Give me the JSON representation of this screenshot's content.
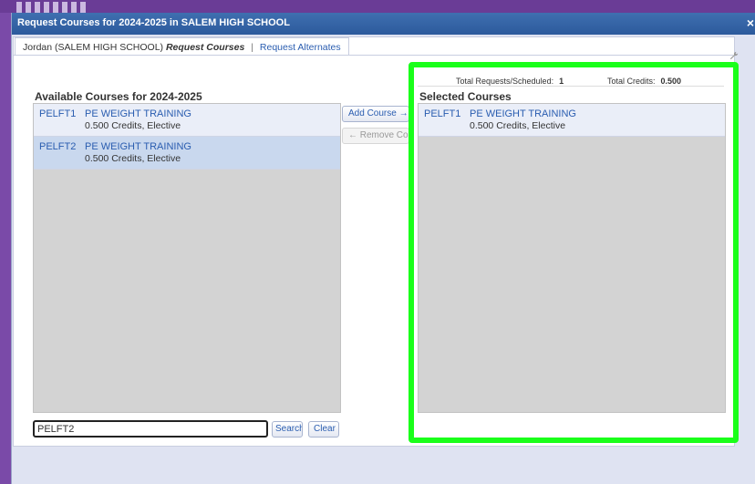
{
  "dialog": {
    "title": "Request Courses for 2024-2025 in SALEM HIGH SCHOOL",
    "close_glyph": "×"
  },
  "tabs": {
    "student": "Jordan (SALEM HIGH SCHOOL)",
    "active": "Request Courses",
    "separator": "|",
    "alternates": "Request Alternates"
  },
  "available": {
    "heading": "Available Courses for 2024-2025",
    "courses": [
      {
        "code": "PELFT1",
        "name": "PE WEIGHT TRAINING",
        "meta": "0.500 Credits,  Elective"
      },
      {
        "code": "PELFT2",
        "name": "PE WEIGHT TRAINING",
        "meta": "0.500 Credits,  Elective"
      }
    ]
  },
  "actions": {
    "add_label": "Add Course →",
    "remove_label": "← Remove Course"
  },
  "search": {
    "value": "PELFT2",
    "search_label": "Search",
    "clear_label": "Clear"
  },
  "totals": {
    "requests_label": "Total Requests/Scheduled:",
    "requests_value": "1",
    "credits_label": "Total Credits:",
    "credits_value": "0.500"
  },
  "selected": {
    "heading": "Selected Courses",
    "courses": [
      {
        "code": "PELFT1",
        "name": "PE WEIGHT TRAINING",
        "meta": "0.500 Credits,  Elective"
      }
    ]
  },
  "colors": {
    "highlight": "#1aff1a",
    "titlebar": "#2c5a9c",
    "link": "#2a5db0",
    "background": "#7a4aa8"
  },
  "icons": {
    "close": "close-icon",
    "settings": "wrench-icon"
  }
}
